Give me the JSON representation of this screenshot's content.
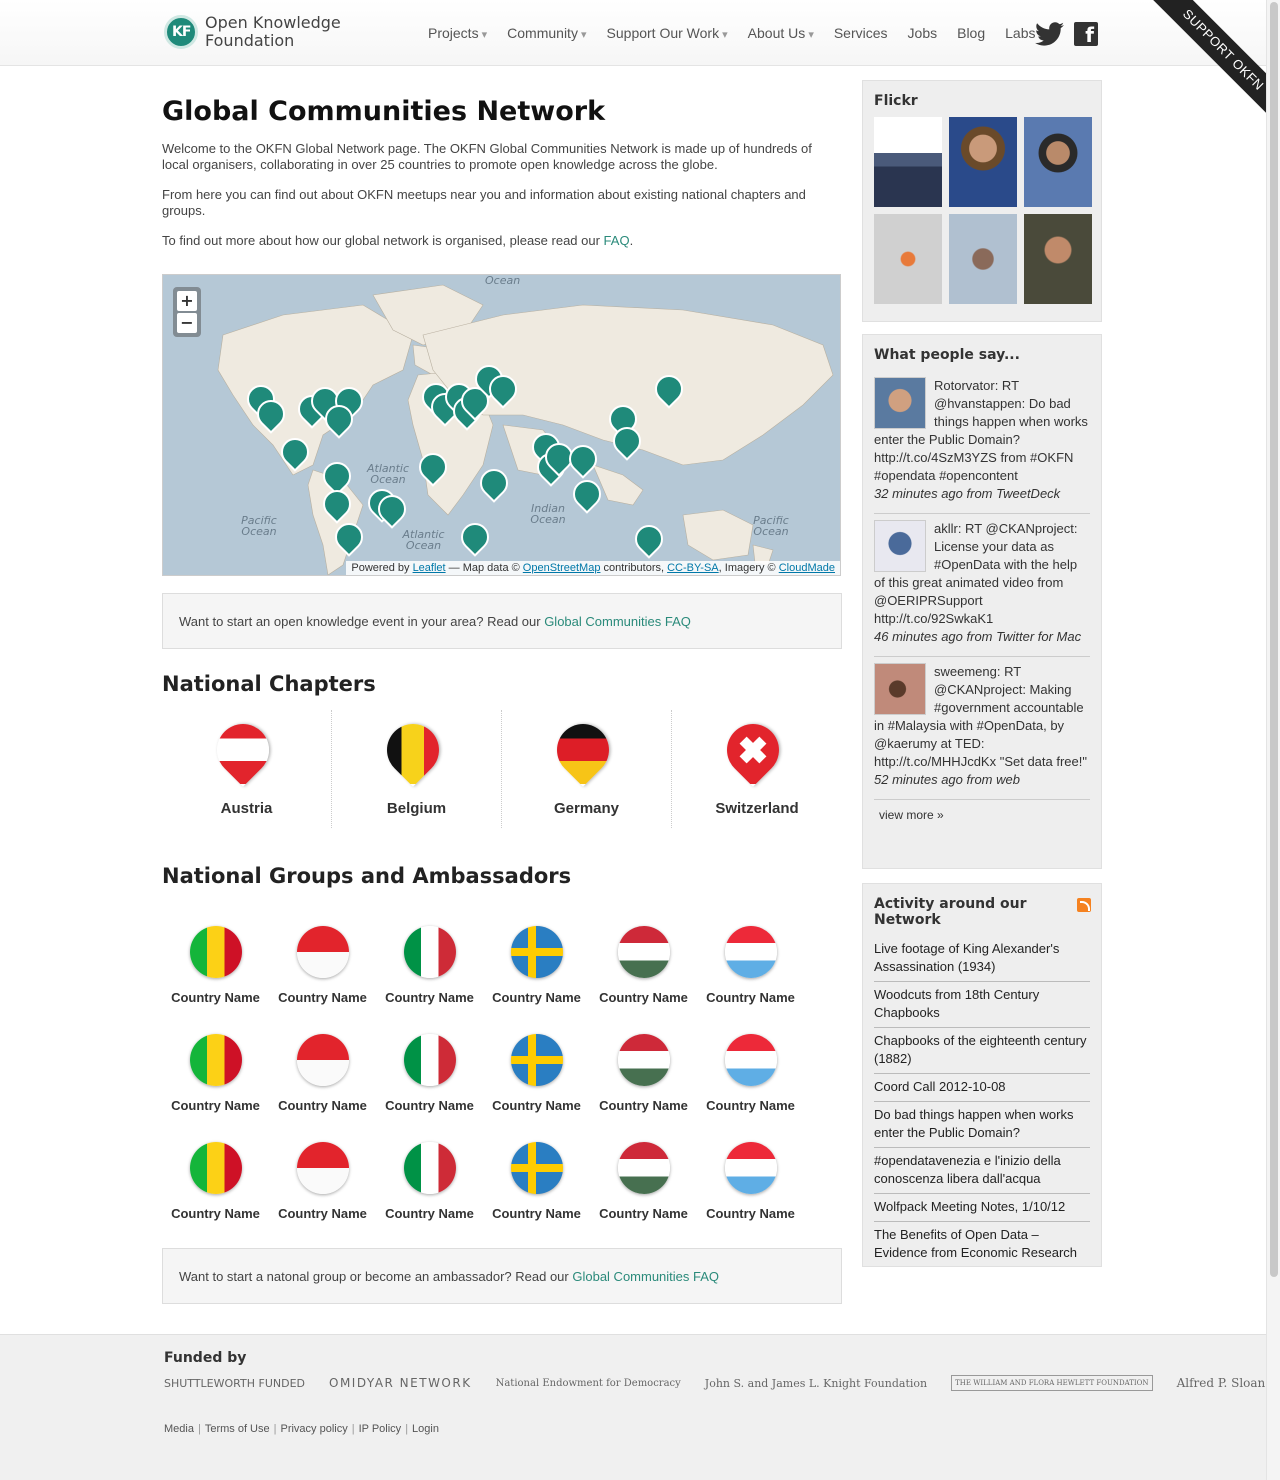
{
  "header": {
    "logo_line1": "Open Knowledge",
    "logo_line2": "Foundation",
    "nav": [
      {
        "label": "Projects",
        "dropdown": true
      },
      {
        "label": "Community",
        "dropdown": true
      },
      {
        "label": "Support Our Work",
        "dropdown": true
      },
      {
        "label": "About Us",
        "dropdown": true
      },
      {
        "label": "Services",
        "dropdown": false
      },
      {
        "label": "Jobs",
        "dropdown": false
      },
      {
        "label": "Blog",
        "dropdown": false
      },
      {
        "label": "Labs",
        "dropdown": false
      }
    ],
    "social": [
      "twitter-icon",
      "facebook-icon"
    ],
    "facebook_glyph": "f",
    "ribbon": "SUPPORT OKFN"
  },
  "main": {
    "title": "Global Communities Network",
    "intro": [
      "Welcome to the OKFN Global Network page. The OKFN Global Communities Network is made up of hundreds of local organisers, collaborating in over 25 countries to promote open knowledge across the globe.",
      "From here you can find out about OKFN meetups near you and information about existing national chapters and groups."
    ],
    "faq_prefix": "To find out more about how our global network is organised, please read our ",
    "faq_link": "FAQ",
    "faq_suffix": ".",
    "map": {
      "zoom_in": "+",
      "zoom_out": "−",
      "ocean_labels": [
        "Ocean",
        "Atlantic Ocean",
        "Indian Ocean",
        "Pacific Ocean",
        "Atlantic Ocean",
        "Pacific Ocean"
      ],
      "attribution_prefix": "Powered by ",
      "attribution_leaflet": "Leaflet",
      "attribution_mid": " — Map data © ",
      "attribution_osm": "OpenStreetMap",
      "attribution_contrib": " contributors, ",
      "attribution_cc": "CC-BY-SA",
      "attribution_imagery": ", Imagery © ",
      "attribution_cloudmade": "CloudMade",
      "marker_color": "#1f8a7a"
    },
    "event_box_prefix": "Want to start an open knowledge event in your area? Read our ",
    "event_box_link": "Global Communities FAQ",
    "chapters_heading": "National Chapters",
    "chapters": [
      "Austria",
      "Belgium",
      "Germany",
      "Switzerland"
    ],
    "groups_heading": "National Groups and Ambassadors",
    "group_label": "Country Name",
    "group_box_prefix": "Want to start a natonal group or become an ambassador? Read our ",
    "group_box_link": "Global Communities FAQ"
  },
  "sidebar": {
    "flickr_title": "Flickr",
    "tweets_title": "What people say...",
    "tweets": [
      {
        "text": "Rotorvator: RT @hvanstappen: Do bad things happen when works enter the Public Domain? http://t.co/4SzM3YZS from #OKFN #opendata #opencontent",
        "meta": "32 minutes ago from TweetDeck"
      },
      {
        "text": "akllr: RT @CKANproject: License your data as #OpenData with the help of this great animated video from @OERIPRSupport http://t.co/92SwkaK1",
        "meta": "46 minutes ago from Twitter for Mac"
      },
      {
        "text": "sweemeng: RT @CKANproject: Making #government accountable in #Malaysia with #OpenData, by @kaerumy at TED: http://t.co/MHHJcdKx \"Set data free!\"",
        "meta": "52 minutes ago from web"
      }
    ],
    "view_more": "view more »",
    "activity_title": "Activity around our Network",
    "activity": [
      "Live footage of King Alexander's Assassination (1934)",
      "Woodcuts from 18th Century Chapbooks",
      "Chapbooks of the eighteenth century (1882)",
      "Coord Call 2012-10-08",
      "Do bad things happen when works enter the Public Domain?",
      "#opendatavenezia e l'inizio della conoscenza libera dall'acqua",
      "Wolfpack Meeting Notes, 1/10/12",
      "The Benefits of Open Data – Evidence from Economic Research"
    ]
  },
  "footer": {
    "funded_by": "Funded by",
    "funders": [
      "SHUTTLEWORTH FUNDED",
      "OMIDYAR NETWORK",
      "National Endowment for Democracy",
      "John S. and James L. Knight Foundation",
      "THE WILLIAM AND FLORA HEWLETT FOUNDATION",
      "Alfred P. Sloan Foundation"
    ],
    "links": [
      "Media",
      "Terms of Use",
      "Privacy policy",
      "IP Policy",
      "Login"
    ]
  }
}
